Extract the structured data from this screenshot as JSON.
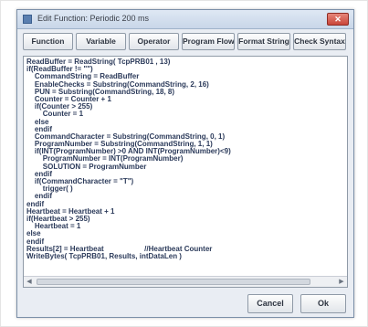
{
  "window": {
    "title": "Edit Function: Periodic 200 ms"
  },
  "toolbar": {
    "buttons": [
      "Function",
      "Variable",
      "Operator",
      "Program Flow",
      "Format String",
      "Check Syntax"
    ]
  },
  "editor": {
    "lines": [
      "ReadBuffer = ReadString( TcpPRB01 , 13)",
      "if(ReadBuffer != \"\")",
      "    CommandString = ReadBuffer",
      "    EnableChecks = Substring(CommandString, 2, 16)",
      "    PUN = Substring(CommandString, 18, 8)",
      "    Counter = Counter + 1",
      "    if(Counter > 255)",
      "        Counter = 1",
      "    else",
      "    endif",
      "    CommandCharacter = Substring(CommandString, 0, 1)",
      "    ProgramNumber = Substring(CommandString, 1, 1)",
      "    if(INT(ProgramNumber) >0 AND INT(ProgramNumber)<9)",
      "        ProgramNumber = INT(ProgramNumber)",
      "        SOLUTION = ProgramNumber",
      "    endif",
      "    if(CommandCharacter = \"T\")",
      "        trigger( )",
      "    endif",
      "endif",
      "Heartbeat = Heartbeat + 1",
      "if(Heartbeat > 255)",
      "    Heartbeat = 1",
      "else",
      "endif",
      "Results[2] = Heartbeat                    //Heartbeat Counter",
      "WriteBytes( TcpPRB01, Results, intDataLen )"
    ]
  },
  "footer": {
    "cancel_label": "Cancel",
    "ok_label": "Ok"
  }
}
